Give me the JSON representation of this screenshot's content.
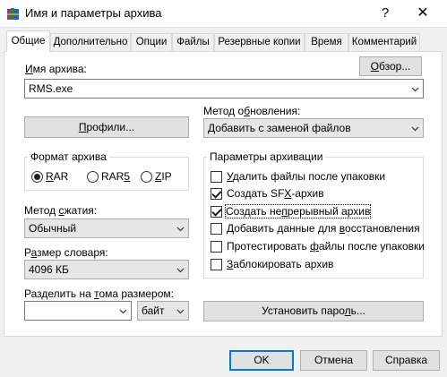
{
  "window": {
    "title": "Имя и параметры архива",
    "help_symbol": "?",
    "close_symbol": "✕"
  },
  "tabs": [
    {
      "label": "Общие",
      "active": true
    },
    {
      "label": "Дополнительно"
    },
    {
      "label": "Опции"
    },
    {
      "label": "Файлы"
    },
    {
      "label": "Резервные копии"
    },
    {
      "label": "Время"
    },
    {
      "label": "Комментарий"
    }
  ],
  "archive_name": {
    "label_accel": "И",
    "label_rest": "мя архива:",
    "value": "RMS.exe",
    "browse_accel": "О",
    "browse_rest": "бзор..."
  },
  "profiles": {
    "accel": "П",
    "rest": "рофили..."
  },
  "update_method": {
    "label_a": "Метод о",
    "label_accel": "б",
    "label_b": "новления:",
    "value": "Добавить с заменой файлов"
  },
  "archive_format": {
    "title": "Формат архива",
    "options": [
      {
        "pre": "",
        "accel": "R",
        "post": "AR",
        "selected": true
      },
      {
        "pre": "RAR",
        "accel": "5",
        "post": "",
        "selected": false
      },
      {
        "pre": "",
        "accel": "Z",
        "post": "IP",
        "selected": false
      }
    ]
  },
  "compression": {
    "label_a": "Метод ",
    "label_accel": "с",
    "label_b": "жатия:",
    "value": "Обычный"
  },
  "dictionary": {
    "label_a": "Р",
    "label_accel": "а",
    "label_b": "змер словаря:",
    "value": "4096 КБ"
  },
  "split": {
    "label_a": "Разделить на ",
    "label_accel": "т",
    "label_b": "ома размером:",
    "value": "",
    "unit": "байт"
  },
  "archive_options": {
    "title": "Параметры архивации",
    "items": [
      {
        "pre": "",
        "accel": "У",
        "post": "далить файлы после упаковки",
        "checked": false
      },
      {
        "pre": "Создать SF",
        "accel": "X",
        "post": "-архив",
        "checked": true
      },
      {
        "pre": "Создать не",
        "accel": "п",
        "post": "рерывный архив",
        "checked": true,
        "focused": true
      },
      {
        "pre": "Добавить данные для ",
        "accel": "в",
        "post": "осстановления",
        "checked": false
      },
      {
        "pre": "Протестировать ",
        "accel": "ф",
        "post": "айлы после упаковки",
        "checked": false
      },
      {
        "pre": "",
        "accel": "З",
        "post": "аблокировать архив",
        "checked": false
      }
    ]
  },
  "set_password": {
    "pre": "Установить паро",
    "accel": "л",
    "post": "ь..."
  },
  "footer": {
    "ok": "OK",
    "cancel": "Отмена",
    "help": "Справка"
  },
  "colors": {
    "accent": "#0078d7",
    "tab_border": "#d9d9d9",
    "panel": "#ffffff",
    "window": "#f0f0f0"
  },
  "icons": {
    "app": "winrar-books-icon",
    "chevron": "chevron-down-icon"
  }
}
